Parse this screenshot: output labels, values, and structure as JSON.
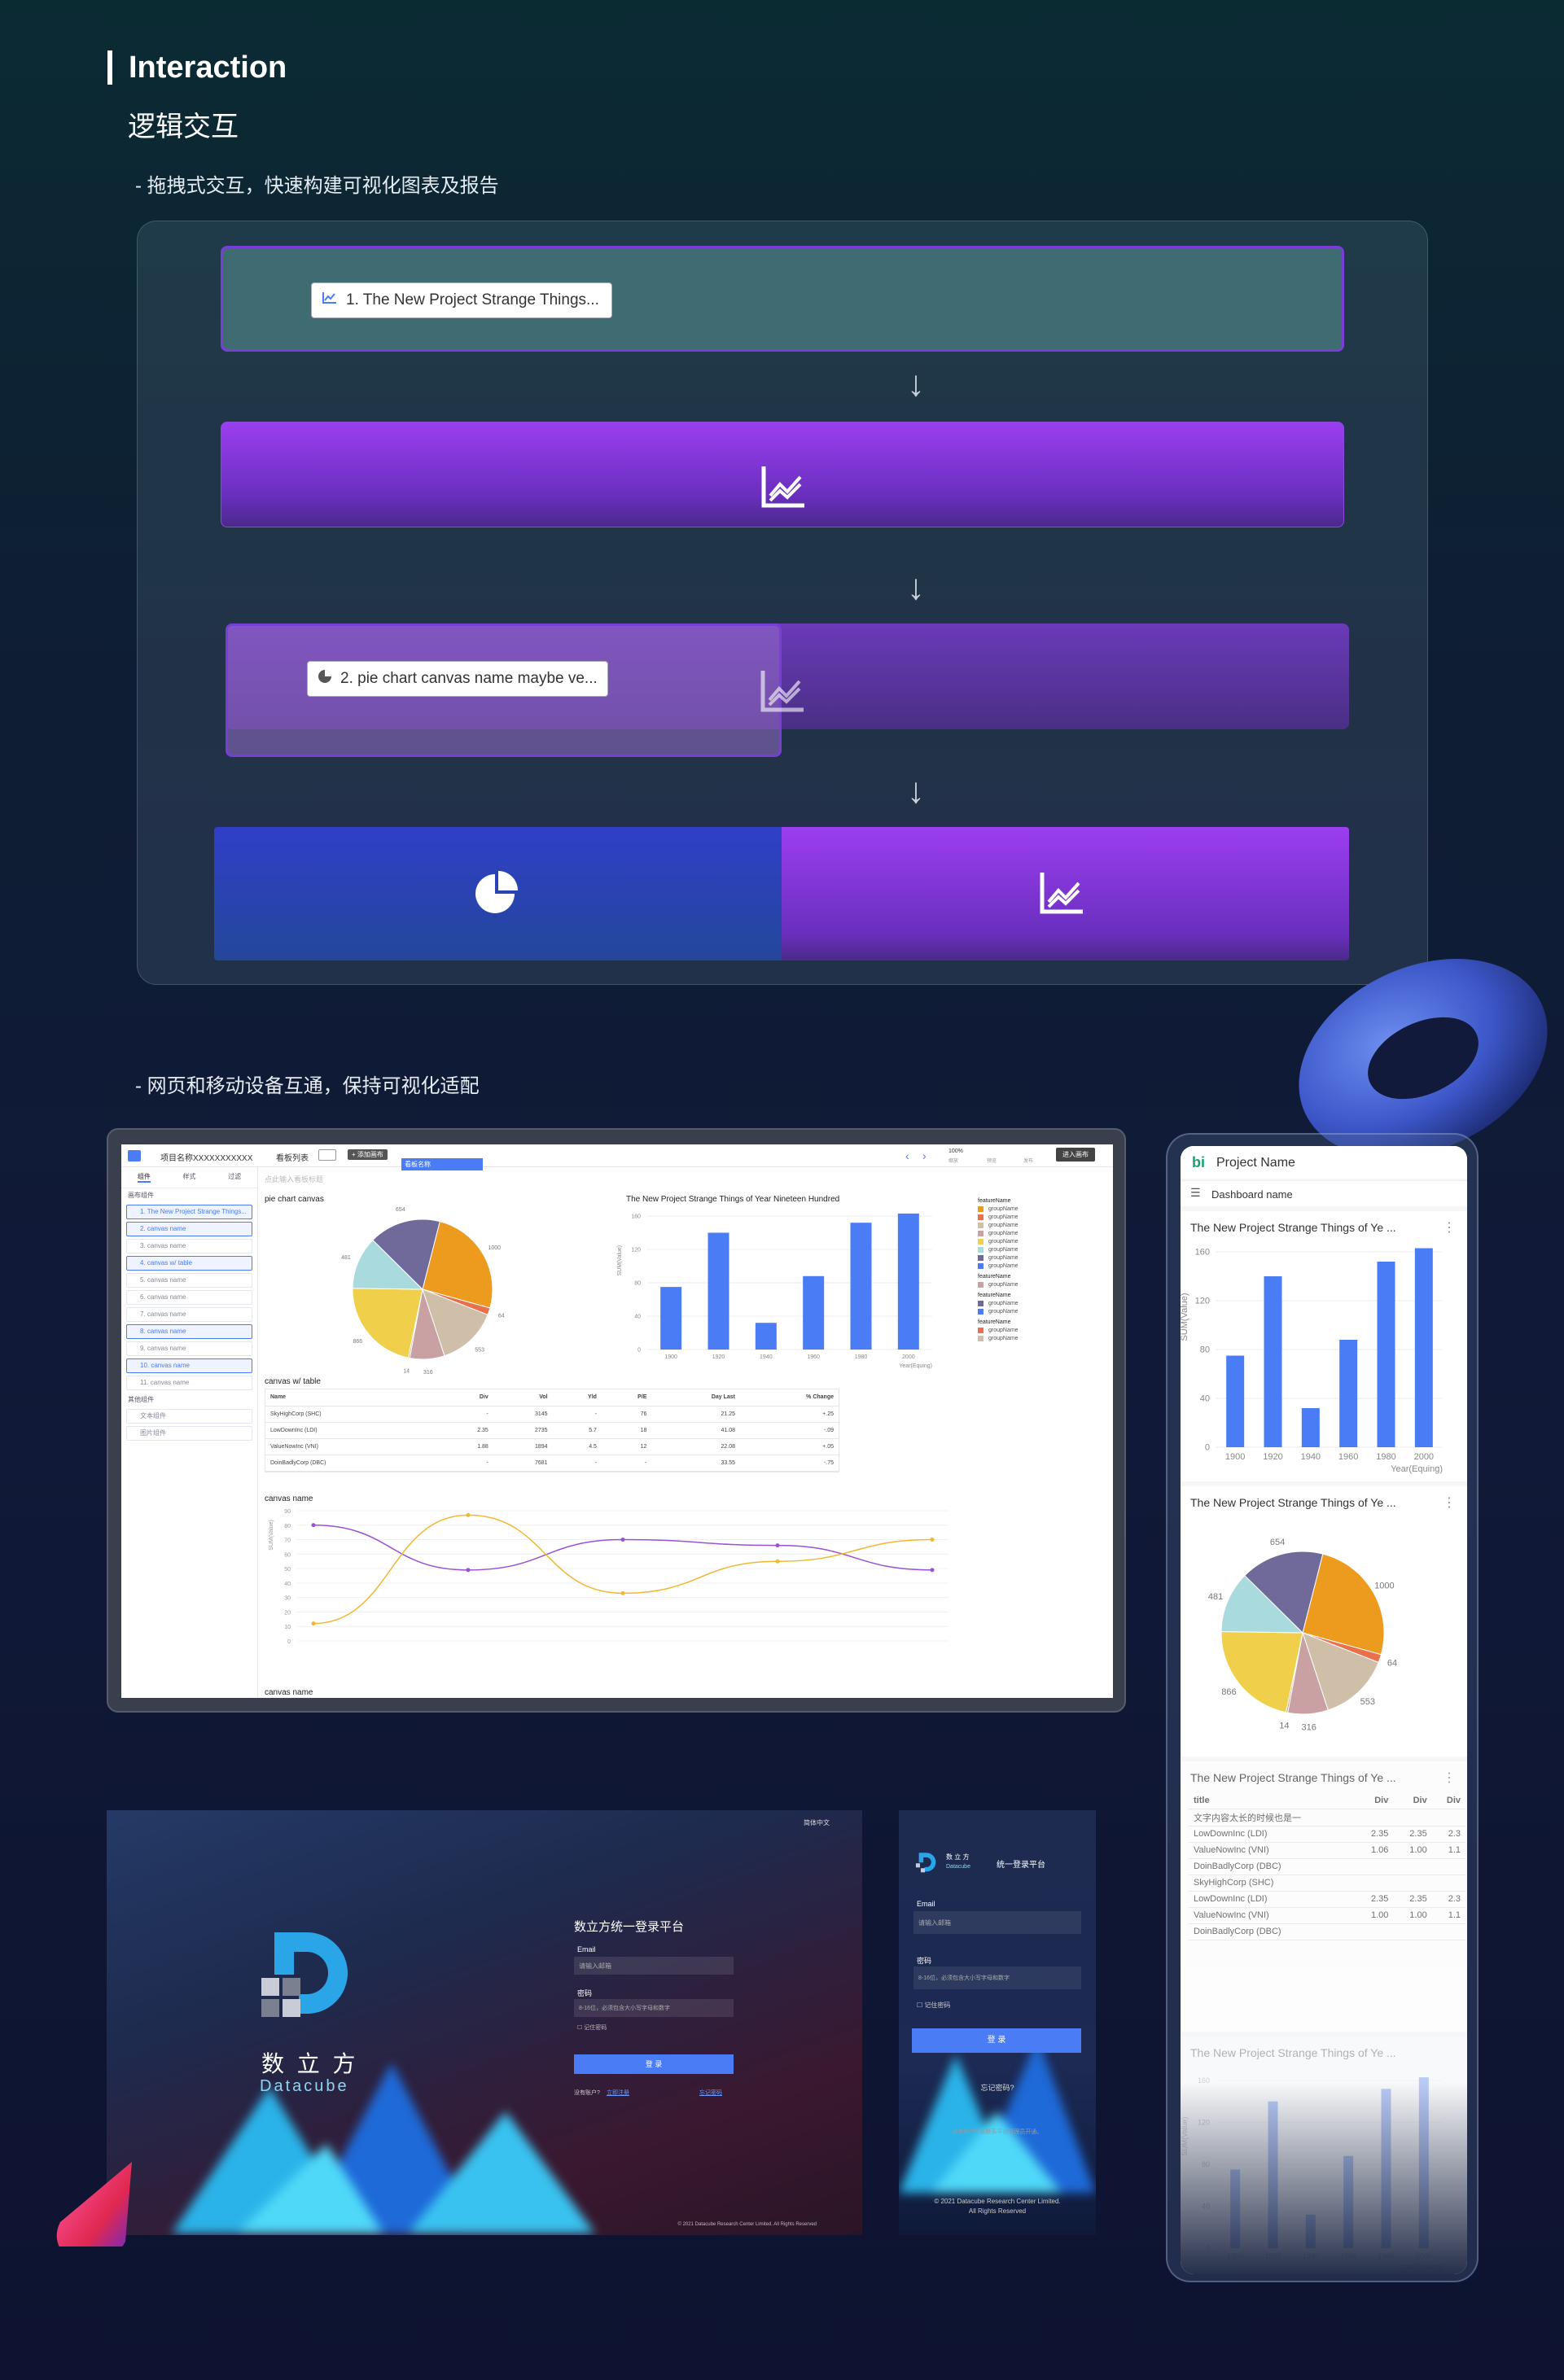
{
  "section_title": "Interaction",
  "section_subtitle": "逻辑交互",
  "bullet_1": "- 拖拽式交互，快速构建可视化图表及报告",
  "bullet_2": "- 网页和移动设备互通，保持可视化适配",
  "flow": {
    "chip_1": "1. The New Project Strange Things...",
    "chip_2": "2. pie chart canvas name maybe ve..."
  },
  "desktop": {
    "project_name": "项目名称XXXXXXXXXXX",
    "dashboard_list": "看板列表",
    "add_canvas": "+ 添加画布",
    "active_tab": "看板名称",
    "zoom": "100%",
    "zoom_label": "缩放",
    "preview_label": "预览",
    "publish_label": "发布",
    "enter_canvas": "进入画布",
    "side_tabs": [
      "组件",
      "样式",
      "过滤"
    ],
    "side_group_1": "画布组件",
    "side_items": [
      "1. The New Project Strange Things...",
      "2. canvas name",
      "3. canvas name",
      "4. canvas w/ table",
      "5. canvas name",
      "6. canvas name",
      "7. canvas name",
      "8. canvas name",
      "9. canvas name",
      "10. canvas name",
      "11. canvas name"
    ],
    "side_group_2": "其他组件",
    "side_other": [
      "文本组件",
      "图片组件"
    ],
    "title_placeholder": "点此输入看板标题",
    "pie_title": "pie chart canvas",
    "bar_title": "The New Project Strange Things of Year Nineteen Hundred",
    "bar_ylabel": "SUM(Value)",
    "bar_xlabel": "Year(Equing)",
    "table_title": "canvas w/ table",
    "table_headers": [
      "Name",
      "Div",
      "Vol",
      "Yld",
      "P/E",
      "Day Last",
      "% Change"
    ],
    "table_rows": [
      [
        "SkyHighCorp (SHC)",
        "-",
        "3145",
        "-",
        "76",
        "21.25",
        "+.25"
      ],
      [
        "LowDownInc (LDI)",
        "2.35",
        "2735",
        "5.7",
        "18",
        "41.08",
        "-.09"
      ],
      [
        "ValueNowInc (VNI)",
        "1.88",
        "1894",
        "4.5",
        "12",
        "22.08",
        "+.05"
      ],
      [
        "DoinBadlyCorp (DBC)",
        "-",
        "7681",
        "-",
        "-",
        "33.55",
        "-.75"
      ]
    ],
    "line_title": "canvas name",
    "line_ylabel": "SUM(Value)",
    "bottom_title": "canvas name",
    "legend_headers": [
      "featureName",
      "featureName",
      "featureName",
      "featureName"
    ],
    "legend_item": "groupName"
  },
  "mobile": {
    "project": "Project Name",
    "dashboard": "Dashboard name",
    "card_title": "The New Project Strange Things of Ye ...",
    "bar_ylabel": "SUM(Value)",
    "bar_xlabel": "Year(Equing)",
    "table_headers": [
      "title",
      "Div",
      "Div",
      "Div"
    ],
    "table_rows": [
      [
        "文字内容太长的时候也是一",
        "",
        "",
        ""
      ],
      [
        "LowDownInc (LDI)",
        "2.35",
        "2.35",
        "2.3"
      ],
      [
        "ValueNowInc (VNI)",
        "1.06",
        "1.00",
        "1.1"
      ],
      [
        "DoinBadlyCorp (DBC)",
        "",
        "",
        ""
      ],
      [
        "SkyHighCorp (SHC)",
        "",
        "",
        ""
      ],
      [
        "LowDownInc (LDI)",
        "2.35",
        "2.35",
        "2.3"
      ],
      [
        "ValueNowInc (VNI)",
        "1.00",
        "1.00",
        "1.1"
      ],
      [
        "DoinBadlyCorp (DBC)",
        "",
        "",
        ""
      ]
    ]
  },
  "login_desktop": {
    "brand_cn": "数 立 方",
    "brand_en": "Datacube",
    "lang": "简体中文",
    "heading": "数立方统一登录平台",
    "email_label": "Email",
    "email_placeholder": "请输入邮箱",
    "pwd_label": "密码",
    "pwd_placeholder": "8-16位，必须包含大小写字母和数字",
    "remember": "记住密码",
    "submit": "登 录",
    "no_account": "没有账户?",
    "register": "立即注册",
    "forgot": "忘记密码",
    "footer": "© 2021 Datacube Research Center Limited. All Rights Reserved"
  },
  "login_mobile": {
    "brand_cn": "数 立 方",
    "brand_en": "Datacube",
    "heading": "统一登录平台",
    "email_label": "Email",
    "email_placeholder": "请输入邮箱",
    "pwd_label": "密码",
    "pwd_placeholder": "8-16位，必须包含大小写字母和数字",
    "remember": "记住密码",
    "submit": "登 录",
    "forgot": "忘记密码?",
    "hint": "没有账户? 请联系平台管理员开通。",
    "footer_1": "© 2021 Datacube Research Center Limited.",
    "footer_2": "All Rights Reserved"
  },
  "chart_data": [
    {
      "type": "bar",
      "title": "The New Project Strange Things of Year Nineteen Hundred",
      "xlabel": "Year(Equing)",
      "ylabel": "SUM(Value)",
      "categories": [
        "1900",
        "1920",
        "1940",
        "1960",
        "1980",
        "2000"
      ],
      "values": [
        75,
        140,
        32,
        88,
        152,
        163
      ],
      "ylim": [
        0,
        160
      ],
      "yticks": [
        0,
        40,
        80,
        120,
        160
      ]
    },
    {
      "type": "pie",
      "title": "pie chart canvas",
      "labels": [
        "1000",
        "64",
        "553",
        "316",
        "14",
        "866",
        "481",
        "654"
      ],
      "values": [
        1000,
        64,
        553,
        316,
        14,
        866,
        481,
        654
      ],
      "colors": [
        "#ec9b1e",
        "#ea6f4d",
        "#cfbea8",
        "#c9a1a2",
        "#e0a080",
        "#f0cf4a",
        "#a9dade",
        "#6f6a99"
      ]
    },
    {
      "type": "line",
      "title": "canvas name",
      "ylabel": "SUM(Value)",
      "ylim": [
        0,
        90
      ],
      "series": [
        {
          "values": [
            80,
            49,
            70,
            66,
            49
          ],
          "color": "#9a52d4"
        },
        {
          "values": [
            12,
            87,
            33,
            55,
            70
          ],
          "color": "#f0b830"
        }
      ]
    }
  ],
  "colors": {
    "accent": "#4a7cf5",
    "purple": "#9b3ef0",
    "deep_blue": "#2a3ec0"
  }
}
